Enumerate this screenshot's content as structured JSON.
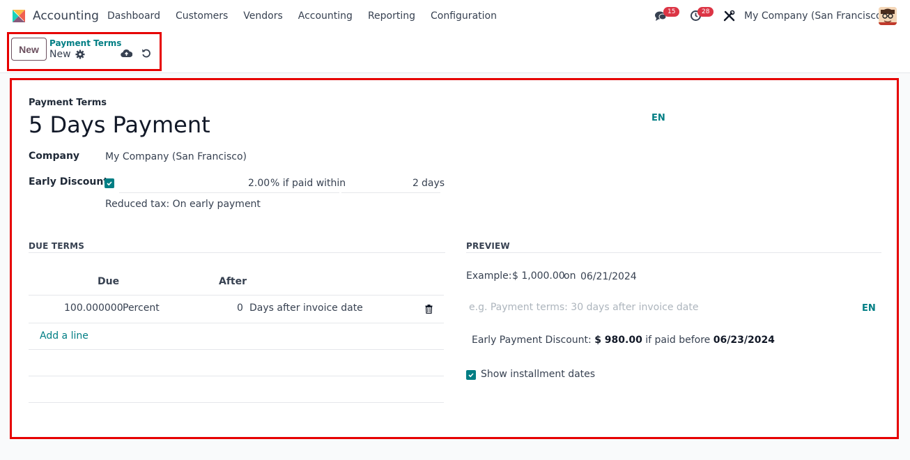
{
  "app": {
    "name": "Accounting"
  },
  "menu": [
    {
      "label": "Dashboard"
    },
    {
      "label": "Customers"
    },
    {
      "label": "Vendors"
    },
    {
      "label": "Accounting"
    },
    {
      "label": "Reporting"
    },
    {
      "label": "Configuration"
    }
  ],
  "systray": {
    "messages_count": "15",
    "activities_count": "28",
    "company": "My Company (San Francisco)"
  },
  "control": {
    "new_label": "New",
    "breadcrumb_parent": "Payment Terms",
    "breadcrumb_current": "New"
  },
  "form": {
    "name_label": "Payment Terms",
    "name_value": "5 Days Payment",
    "lang_badge": "EN",
    "company_label": "Company",
    "company_value": "My Company (San Francisco)",
    "early_discount_label": "Early Discount",
    "discount_percent": "2.00",
    "discount_text": "% if paid within",
    "discount_days": "2",
    "days_unit": "days",
    "reduced_tax": "Reduced tax: On early payment"
  },
  "due_terms": {
    "section_title": "DUE TERMS",
    "col_due": "Due",
    "col_after": "After",
    "rows": [
      {
        "value": "100.000000",
        "type": "Percent",
        "after": "0",
        "after_type": "Days after invoice date"
      }
    ],
    "add_line": "Add a line"
  },
  "preview": {
    "section_title": "PREVIEW",
    "example_label": "Example:",
    "example_amount": "$ 1,000.00",
    "on_label": "on",
    "example_date": "06/21/2024",
    "note_placeholder": "e.g. Payment terms: 30 days after invoice date",
    "lang_badge": "EN",
    "epd_label": "Early Payment Discount:",
    "epd_amount": "$ 980.00",
    "epd_text": "if paid before",
    "epd_date": "06/23/2024",
    "show_installments": "Show installment dates"
  },
  "colors": {
    "accent": "#017e84",
    "brand_btn": "#6b4f5e",
    "badge": "#dc3545",
    "highlight": "#e60000"
  }
}
